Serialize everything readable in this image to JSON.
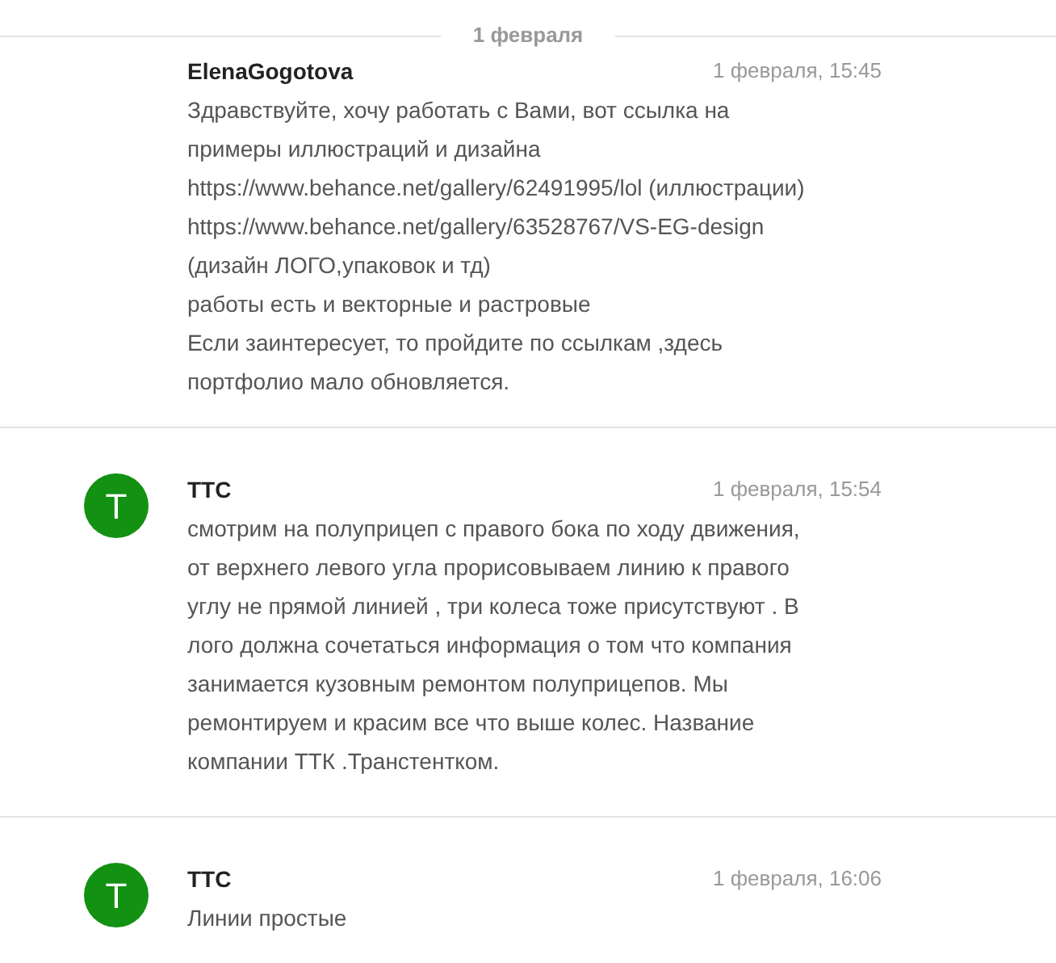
{
  "date_divider": "1 февраля",
  "messages": [
    {
      "author": "ElenaGogotova",
      "time": "1 февраля, 15:45",
      "text": "Здравствуйте, хочу работать с Вами, вот ссылка на\nпримеры иллюстраций и дизайна\nhttps://www.behance.net/gallery/62491995/lol (иллюстрации)\nhttps://www.behance.net/gallery/63528767/VS-EG-design\n(дизайн ЛОГО,упаковок и тд)\nработы есть и векторные и растровые\nЕсли заинтересует, то пройдите по ссылкам ,здесь\nпортфолио мало обновляется."
    },
    {
      "author": "TTC",
      "avatar": {
        "letter": "T",
        "color": "#129112"
      },
      "time": "1 февраля, 15:54",
      "text": "смотрим на полуприцеп с правого бока по ходу движения,\nот верхнего левого угла прорисовываем линию к правого\nуглу не прямой линией , три колеса тоже присутствуют . В\nлого должна сочетаться информация о том что компания\nзанимается кузовным ремонтом полуприцепов. Мы\nремонтируем и красим все что выше колес. Название\nкомпании ТТК .Транстентком."
    },
    {
      "author": "TTC",
      "avatar": {
        "letter": "T",
        "color": "#129112"
      },
      "time": "1 февраля, 16:06",
      "text": "Линии простые"
    }
  ]
}
